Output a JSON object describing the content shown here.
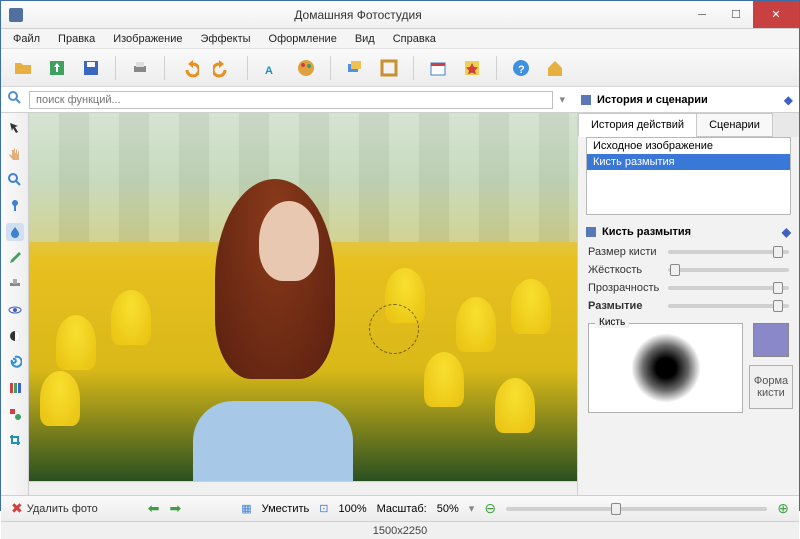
{
  "window": {
    "title": "Домашняя Фотостудия"
  },
  "menu": [
    "Файл",
    "Правка",
    "Изображение",
    "Эффекты",
    "Оформление",
    "Вид",
    "Справка"
  ],
  "search": {
    "placeholder": "поиск функций..."
  },
  "right": {
    "history_title": "История и сценарии",
    "tabs": {
      "history": "История действий",
      "scenarios": "Сценарии"
    },
    "history_items": [
      "Исходное изображение",
      "Кисть размытия"
    ],
    "brush_section": "Кисть размытия",
    "props": {
      "size": "Размер кисти",
      "hardness": "Жёсткость",
      "opacity": "Прозрачность",
      "blur": "Размытие"
    },
    "brush_label": "Кисть",
    "shape_label": "Форма кисти"
  },
  "bottom": {
    "delete": "Удалить фото",
    "fit": "Уместить",
    "zoom100": "100%",
    "scale_label": "Масштаб:",
    "scale_value": "50%"
  },
  "status": {
    "dims": "1500x2250"
  }
}
